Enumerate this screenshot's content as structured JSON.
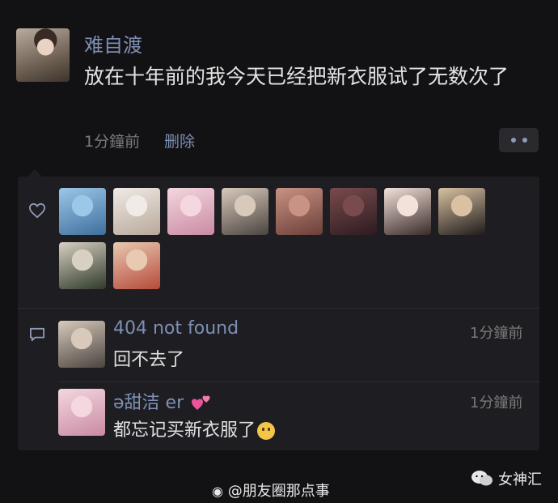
{
  "post": {
    "author": "难自渡",
    "text": "放在十年前的我今天已经把新衣服试了无数次了",
    "time": "1分鐘前",
    "delete_label": "删除"
  },
  "likes": {
    "icon": "heart-outline-icon",
    "avatars": [
      {
        "name": "like-avatar-anime-blue",
        "colors": [
          "#9cc7e8",
          "#3f6f9e"
        ]
      },
      {
        "name": "like-avatar-white-dog",
        "colors": [
          "#f0ebe6",
          "#b8a89a"
        ]
      },
      {
        "name": "like-avatar-anime-pink",
        "colors": [
          "#f4d7df",
          "#c98aa3"
        ]
      },
      {
        "name": "like-avatar-girl-scarf",
        "colors": [
          "#d8c9bb",
          "#4a4440"
        ]
      },
      {
        "name": "like-avatar-closeup",
        "colors": [
          "#c99283",
          "#6b3f38"
        ]
      },
      {
        "name": "like-avatar-girl-dark",
        "colors": [
          "#7a4b4e",
          "#2d1b20"
        ]
      },
      {
        "name": "like-avatar-girl-smile",
        "colors": [
          "#f3e2da",
          "#3a2a2a"
        ]
      },
      {
        "name": "like-avatar-cartoon-black",
        "colors": [
          "#d9c1a2",
          "#1f1b1b"
        ]
      },
      {
        "name": "like-avatar-girl-green",
        "colors": [
          "#d8d0c2",
          "#2f3a2a"
        ]
      },
      {
        "name": "like-avatar-girl-red",
        "colors": [
          "#e9c9b2",
          "#b64a3a"
        ]
      }
    ]
  },
  "comments": {
    "icon": "comment-icon",
    "items": [
      {
        "name": "404 not found",
        "time": "1分鐘前",
        "text": "回不去了",
        "avatar_colors": [
          "#d8c9bb",
          "#4a4440"
        ]
      },
      {
        "name": "ə甜洁 er",
        "time": "1分鐘前",
        "text": "都忘记买新衣服了",
        "emoji_after_name": "pink-hearts-emoji",
        "emoji_after_text": "crying-face-emoji",
        "avatar_colors": [
          "#f4d7df",
          "#c98aa3"
        ]
      }
    ]
  },
  "watermarks": {
    "weibo": "@朋友圈那点事",
    "weibo_icon": "weibo-icon",
    "wechat": "女神汇",
    "wechat_icon": "wechat-icon"
  },
  "colors": {
    "background": "#121214",
    "panel": "#1e1e22",
    "link": "#7d8fb4",
    "muted": "#7a7a7a"
  }
}
